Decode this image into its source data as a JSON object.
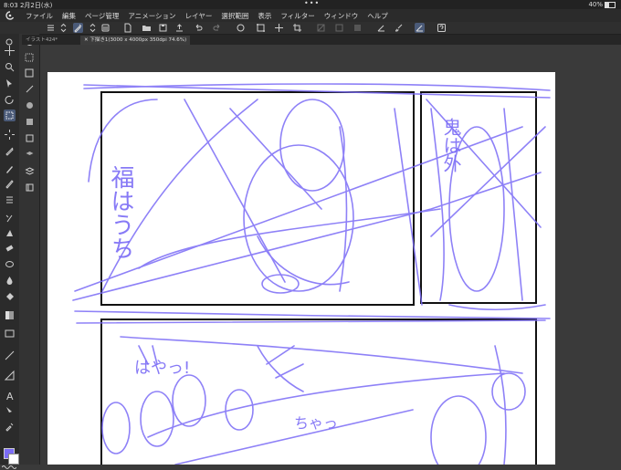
{
  "status": {
    "time": "8:03",
    "date": "2月2日(水)",
    "dots": "•••",
    "battery": "40%"
  },
  "menu": [
    "ファイル",
    "編集",
    "ページ管理",
    "アニメーション",
    "レイヤー",
    "選択範囲",
    "表示",
    "フィルター",
    "ウィンドウ",
    "ヘルプ"
  ],
  "tabs": {
    "inactive": "イラスト424*",
    "active": "下描き1(3000 x 4000px 350dpi 74.6%)"
  },
  "sketch_text": {
    "panel1_vertical": "福はうち",
    "bottom_left": "はやっ!",
    "bottom_mid": "ちゃっ",
    "right_vertical": "鬼は外"
  },
  "colors": {
    "sketch": "#7b6cf6",
    "panel_border": "#111111",
    "paper": "#ffffff",
    "app_bg": "#3a3a3a"
  }
}
